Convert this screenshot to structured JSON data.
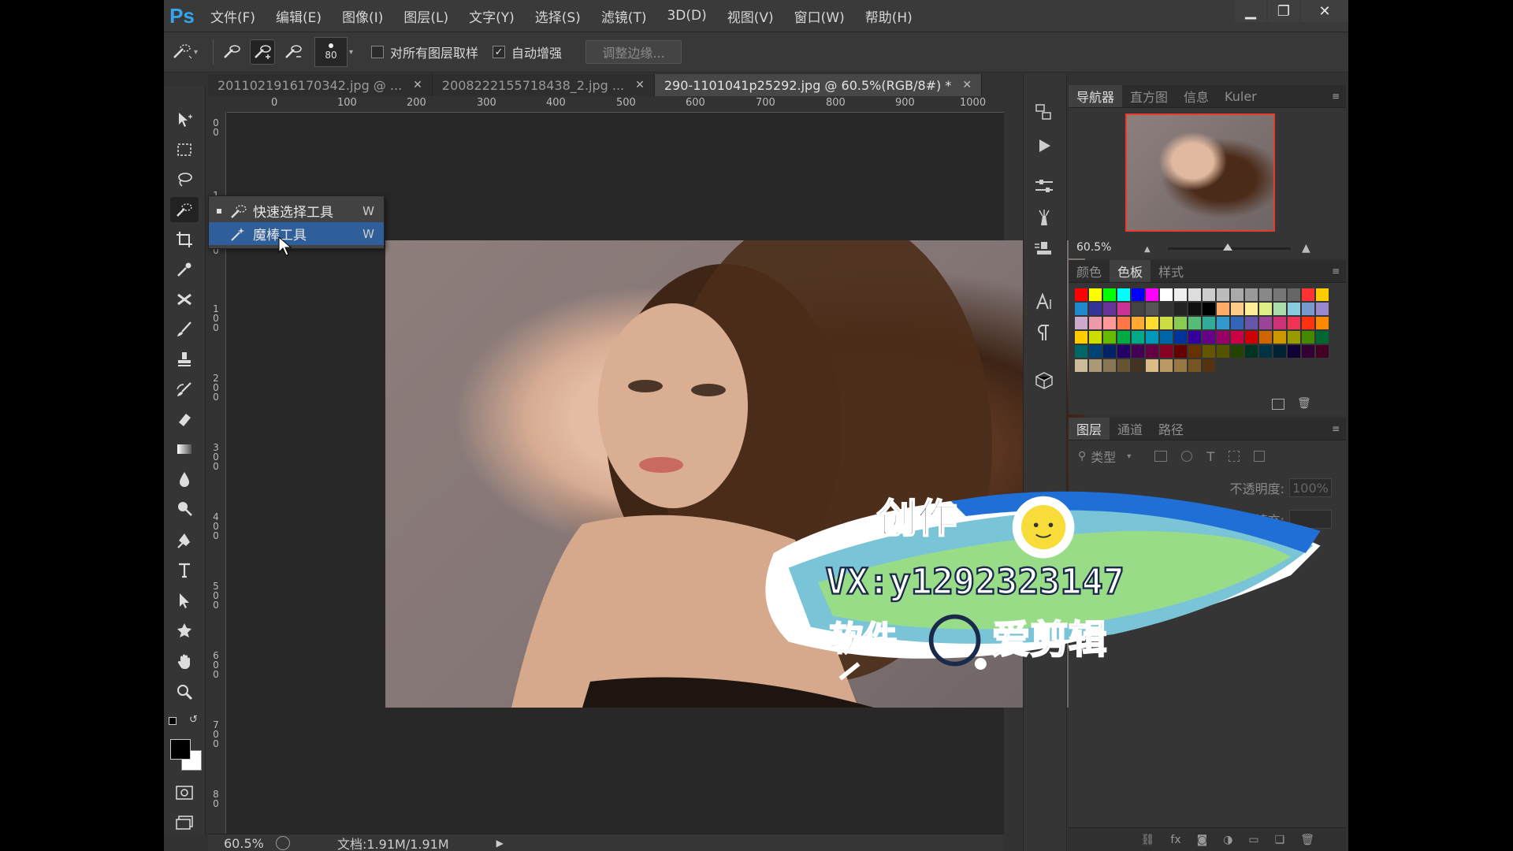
{
  "app": {
    "logo": "Ps",
    "menu": [
      "文件(F)",
      "编辑(E)",
      "图像(I)",
      "图层(L)",
      "文字(Y)",
      "选择(S)",
      "滤镜(T)",
      "3D(D)",
      "视图(V)",
      "窗口(W)",
      "帮助(H)"
    ],
    "window_controls": {
      "minimize": "▁",
      "restore": "❐",
      "close": "✕"
    }
  },
  "options_bar": {
    "brush_size": "80",
    "sample_all_layers_label": "对所有图层取样",
    "sample_all_layers_checked": false,
    "auto_enhance_label": "自动增强",
    "auto_enhance_checked": true,
    "refine_edge_label": "调整边缘..."
  },
  "document_tabs": [
    {
      "label": "2011021916170342.jpg @ ...",
      "active": false
    },
    {
      "label": "2008222155718438_2.jpg ...",
      "active": false
    },
    {
      "label": "290-1101041p25292.jpg @ 60.5%(RGB/8#) *",
      "active": true
    }
  ],
  "rulers": {
    "top": [
      "0",
      "100",
      "200",
      "300",
      "400",
      "500",
      "600",
      "700",
      "800",
      "900",
      "1000"
    ],
    "left": [
      "0\n0",
      "1\n0",
      "0",
      "1\n0\n0",
      "2\n0\n0",
      "3\n0\n0",
      "4\n0\n0",
      "5\n0\n0",
      "6\n0\n0",
      "7\n0\n0",
      "8\n0"
    ]
  },
  "context_menu": {
    "items": [
      {
        "label": "快速选择工具",
        "shortcut": "W",
        "selected": true
      },
      {
        "label": "魔棒工具",
        "shortcut": "W",
        "selected": false
      }
    ]
  },
  "status_bar": {
    "zoom": "60.5%",
    "doc_info": "文档:1.91M/1.91M"
  },
  "navigator": {
    "tabs": [
      "导航器",
      "直方图",
      "信息",
      "Kuler"
    ],
    "zoom": "60.5%"
  },
  "swatches_panel": {
    "tabs": [
      "颜色",
      "色板",
      "样式"
    ]
  },
  "layers_panel": {
    "tabs": [
      "图层",
      "通道",
      "路径"
    ],
    "filter_label": "类型",
    "opacity_label": "不透明度:",
    "opacity_value": "100%",
    "fill_label": "填充:"
  },
  "watermark": {
    "line1": "创作",
    "line2": "VX:y1292323147",
    "line3a": "软件",
    "line3b": "爱剪辑"
  },
  "colors": {
    "accent": "#34a5f0",
    "highlight": "#2f5f9a",
    "navigator_frame": "#e63b2e"
  }
}
